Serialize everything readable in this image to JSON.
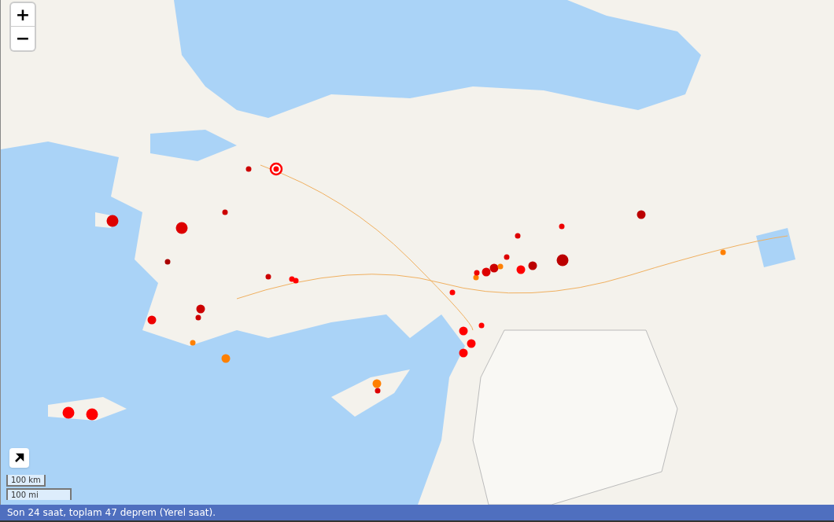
{
  "zoom_controls": [
    {
      "label": "+"
    },
    {
      "label": "−"
    }
  ],
  "markers": [
    {
      "kind": "latest",
      "color": "#ff0000"
    },
    {
      "kind": "small",
      "color": "#cc0000"
    },
    {
      "kind": "small",
      "color": "#cc0000"
    },
    {
      "kind": "large",
      "color": "#dd0000"
    },
    {
      "kind": "large",
      "color": "#dd0000"
    },
    {
      "kind": "small",
      "color": "#aa0000"
    },
    {
      "kind": "small",
      "color": "#cc0000"
    },
    {
      "kind": "small",
      "color": "#ff0000"
    },
    {
      "kind": "small",
      "color": "#ff0000"
    },
    {
      "kind": "medium",
      "color": "#cc0000"
    },
    {
      "kind": "small",
      "color": "#cc0000"
    },
    {
      "kind": "medium",
      "color": "#ee0000"
    },
    {
      "kind": "small",
      "color": "#ff8000"
    },
    {
      "kind": "medium",
      "color": "#ff8000"
    },
    {
      "kind": "large",
      "color": "#ff0000"
    },
    {
      "kind": "large",
      "color": "#ff0000"
    },
    {
      "kind": "medium",
      "color": "#ff8000"
    },
    {
      "kind": "small",
      "color": "#dd0000"
    },
    {
      "kind": "small",
      "color": "#ff0000"
    },
    {
      "kind": "medium",
      "color": "#ff0000"
    },
    {
      "kind": "medium",
      "color": "#ff0000"
    },
    {
      "kind": "medium",
      "color": "#ff0000"
    },
    {
      "kind": "small",
      "color": "#ff0000"
    },
    {
      "kind": "small",
      "color": "#ff8000"
    },
    {
      "kind": "small",
      "color": "#ee0000"
    },
    {
      "kind": "medium",
      "color": "#dd0000"
    },
    {
      "kind": "medium",
      "color": "#cc0000"
    },
    {
      "kind": "small",
      "color": "#ff8000"
    },
    {
      "kind": "small",
      "color": "#dd0000"
    },
    {
      "kind": "small",
      "color": "#dd0000"
    },
    {
      "kind": "medium",
      "color": "#ff0000"
    },
    {
      "kind": "medium",
      "color": "#bb0000"
    },
    {
      "kind": "small",
      "color": "#ee0000"
    },
    {
      "kind": "large",
      "color": "#bb0000"
    },
    {
      "kind": "medium",
      "color": "#bb0000"
    },
    {
      "kind": "small",
      "color": "#ff8000"
    }
  ],
  "scale": {
    "metric": "100 km",
    "imperial": "100 mi"
  },
  "status_bar": "Son 24 saat, toplam 47 deprem (Yerel saat)."
}
